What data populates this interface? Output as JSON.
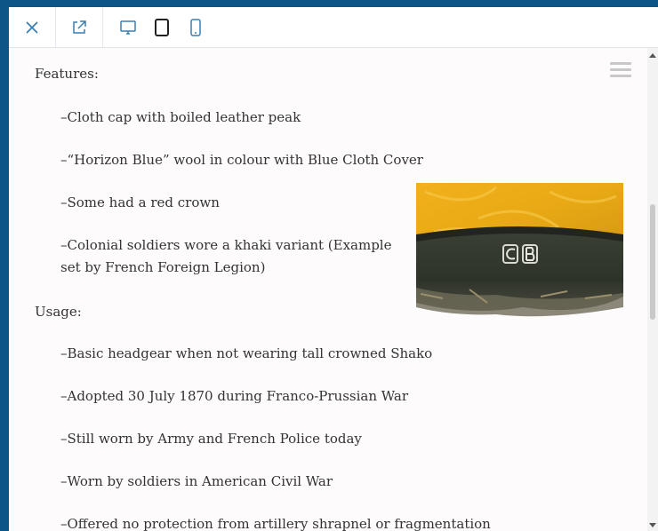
{
  "toolbar": {
    "close": "close-icon",
    "open_external": "external-link-icon",
    "devices": [
      "desktop-icon",
      "tablet-icon",
      "mobile-icon"
    ]
  },
  "content": {
    "features_heading": "Features:",
    "features": [
      "–Cloth cap with boiled leather peak",
      "–“Horizon Blue” wool in colour with Blue Cloth Cover",
      "–Some had a red crown",
      "–Colonial soldiers wore a khaki variant (Example set by French Foreign Legion)"
    ],
    "usage_heading": "Usage:",
    "usage": [
      "–Basic headgear when not wearing tall crowned Shako",
      "–Adopted 30 July 1870 during Franco-Prussian War",
      "–Still worn by Army and French Police today",
      "–Worn by soldiers in American Civil War",
      "–Offered no protection from artillery shrapnel or fragmentation"
    ],
    "image_badge_letters": "CB"
  },
  "colors": {
    "background": "#0d5487",
    "accent": "#3a7fb0",
    "text": "#333333"
  }
}
